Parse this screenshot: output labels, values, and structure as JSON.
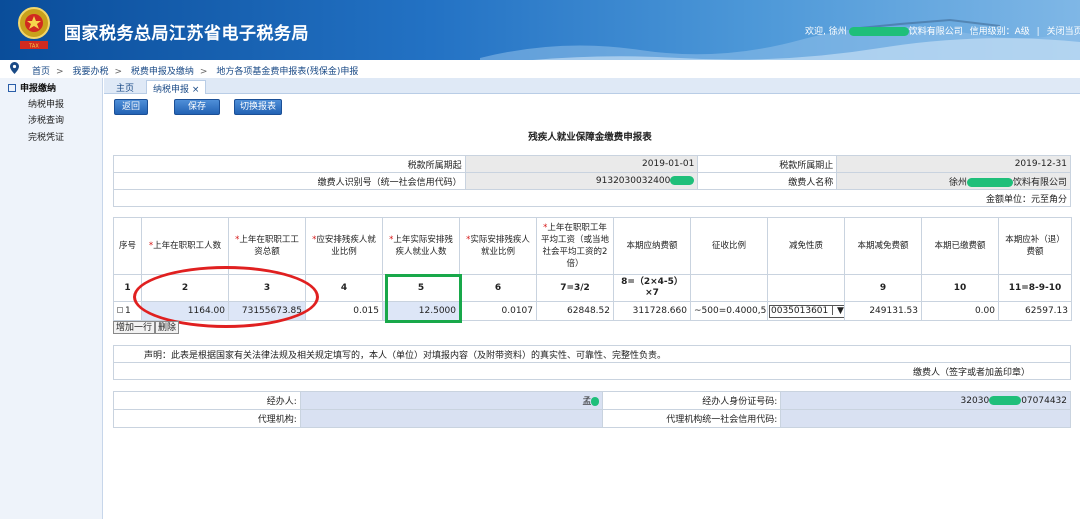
{
  "header": {
    "site_title": "国家税务总局江苏省电子税务局",
    "welcome": "欢迎, 徐州",
    "company_suffix": "饮料有限公司",
    "credit_label": "信用级别：A级",
    "close_label": "关闭当页"
  },
  "breadcrumb": [
    "首页",
    "我要办税",
    "税费申报及缴纳",
    "地方各项基金费申报表(残保金)申报"
  ],
  "sidebar": {
    "heading": "申报缴纳",
    "items": [
      "纳税申报",
      "涉税查询",
      "完税凭证"
    ]
  },
  "tabs": [
    "主页",
    "纳税申报 ×"
  ],
  "toolbar": {
    "back": "返回",
    "save": "保存",
    "switch": "切换报表"
  },
  "form": {
    "title": "残疾人就业保障金缴费申报表",
    "period_start_label": "税款所属期起",
    "period_start": "2019-01-01",
    "period_end_label": "税款所属期止",
    "period_end": "2019-12-31",
    "id_label": "缴费人识别号（统一社会信用代码）",
    "id_value": "9132030032400",
    "name_label": "缴费人名称",
    "name_prefix": "徐州",
    "name_suffix": "饮料有限公司",
    "unit_label": "金额单位：元至角分"
  },
  "grid": {
    "headers": [
      {
        "text": "序号",
        "star": ""
      },
      {
        "text": "上年在职职工人数",
        "star": "*"
      },
      {
        "text": "上年在职职工工资总额",
        "star": "*"
      },
      {
        "text": "应安排残疾人就业比例",
        "star": "*"
      },
      {
        "text": "上年实际安排残疾人就业人数",
        "star": "*"
      },
      {
        "text": "实际安排残疾人就业比例",
        "star": "*"
      },
      {
        "text": "上年在职职工年平均工资（或当地社会平均工资的2倍）",
        "star": "*"
      },
      {
        "text": "本期应纳费额",
        "star": ""
      },
      {
        "text": "征收比例",
        "star": ""
      },
      {
        "text": "减免性质",
        "star": ""
      },
      {
        "text": "本期减免费额",
        "star": ""
      },
      {
        "text": "本期已缴费额",
        "star": ""
      },
      {
        "text": "本期应补（退）费额",
        "star": ""
      }
    ],
    "numbers": [
      "1",
      "2",
      "3",
      "4",
      "5",
      "6",
      "7=3/2",
      "8=（2×4-5）×7",
      "",
      "",
      "9",
      "10",
      "11=8-9-10"
    ],
    "row": {
      "index": "1",
      "employees": "1164.00",
      "wage_total": "73155673.85",
      "required_ratio": "0.015",
      "actual_disabled": "12.5000",
      "actual_ratio": "0.0107",
      "avg_wage": "62848.52",
      "payable": "311728.660",
      "rate": "~500=0.4000,5",
      "relief_code": "0035013601 |",
      "relief_amount": "249131.53",
      "paid": "0.00",
      "due": "62597.13"
    },
    "add_row": "增加一行",
    "delete_row": "删除"
  },
  "declaration": {
    "statement": "声明：此表是根据国家有关法律法规及相关规定填写的，本人（单位）对填报内容（及附带资料）的真实性、可靠性、完整性负责。",
    "signature": "缴费人（签字或者加盖印章）"
  },
  "agent": {
    "handler_label": "经办人:",
    "handler_value": "孟",
    "handler_id_label": "经办人身份证号码:",
    "handler_id_prefix": "32030",
    "handler_id_suffix": "07074432",
    "agency_label": "代理机构:",
    "agency_code_label": "代理机构统一社会信用代码:"
  }
}
